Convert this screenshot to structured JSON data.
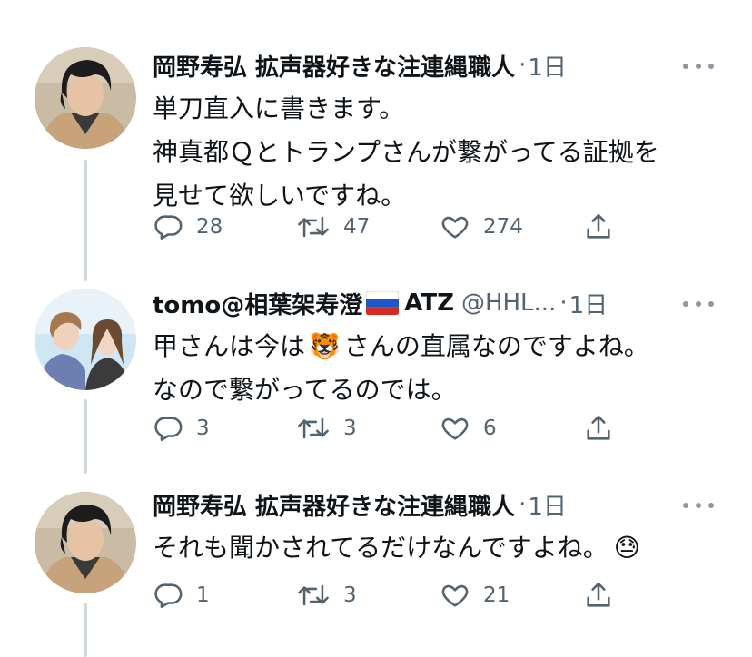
{
  "tweets": [
    {
      "author_name": "岡野寿弘 拡声器好きな注連縄職人",
      "author_handle": "",
      "time": "1日",
      "text_lines": [
        "単刀直入に書きます。",
        "神真都Ｑとトランプさんが繋がってる証拠を",
        "見せて欲しいですね。"
      ],
      "replies": "28",
      "retweets": "47",
      "likes": "274"
    },
    {
      "author_name": "tomo@相葉架寿澄",
      "author_name_suffix": "ATZ",
      "author_handle": "@HHL...",
      "time": "1日",
      "text_line1_before": "甲さんは今は",
      "text_line1_emoji": "🐯",
      "text_line1_after": "さんの直属なのですよね。",
      "text_line2": "なので繋がってるのでは。",
      "replies": "3",
      "retweets": "3",
      "likes": "6"
    },
    {
      "author_name": "岡野寿弘 拡声器好きな注連縄職人",
      "author_handle": "",
      "time": "1日",
      "text_line1": "それも聞かされてるだけなんですよね。",
      "text_emoji": "😓",
      "replies": "1",
      "retweets": "3",
      "likes": "21"
    }
  ],
  "separator_dot": "·",
  "icons": {
    "reply": "reply-icon",
    "retweet": "retweet-icon",
    "like": "heart-icon",
    "share": "share-icon",
    "more": "more-icon",
    "flag": "russia-flag-icon"
  },
  "colors": {
    "text": "#0f1419",
    "secondary": "#536471",
    "connector": "#cfd9de",
    "background": "#ffffff"
  }
}
